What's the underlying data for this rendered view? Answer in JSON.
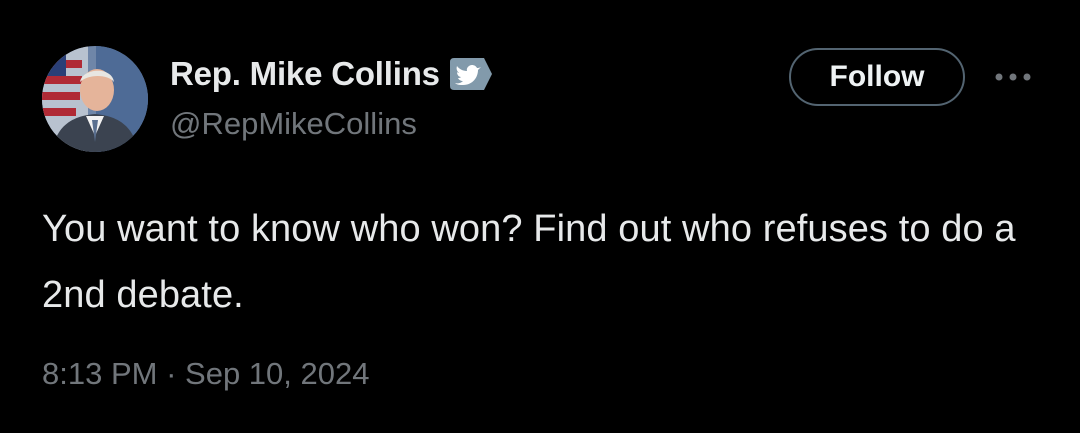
{
  "user": {
    "display_name": "Rep. Mike Collins",
    "handle": "@RepMikeCollins",
    "avatar_icon": "profile-photo",
    "badge_icon": "government-verified-badge",
    "badge_color": "#829aab"
  },
  "actions": {
    "follow_label": "Follow",
    "more_icon": "more-options-icon"
  },
  "tweet": {
    "text": "You want to know who won? Find out who refuses to do a 2nd debate.",
    "time": "8:13 PM",
    "separator": "·",
    "date": "Sep 10, 2024"
  },
  "colors": {
    "background": "#000000",
    "primary_text": "#e7e9ea",
    "secondary_text": "#71767b",
    "follow_border": "#536471"
  }
}
